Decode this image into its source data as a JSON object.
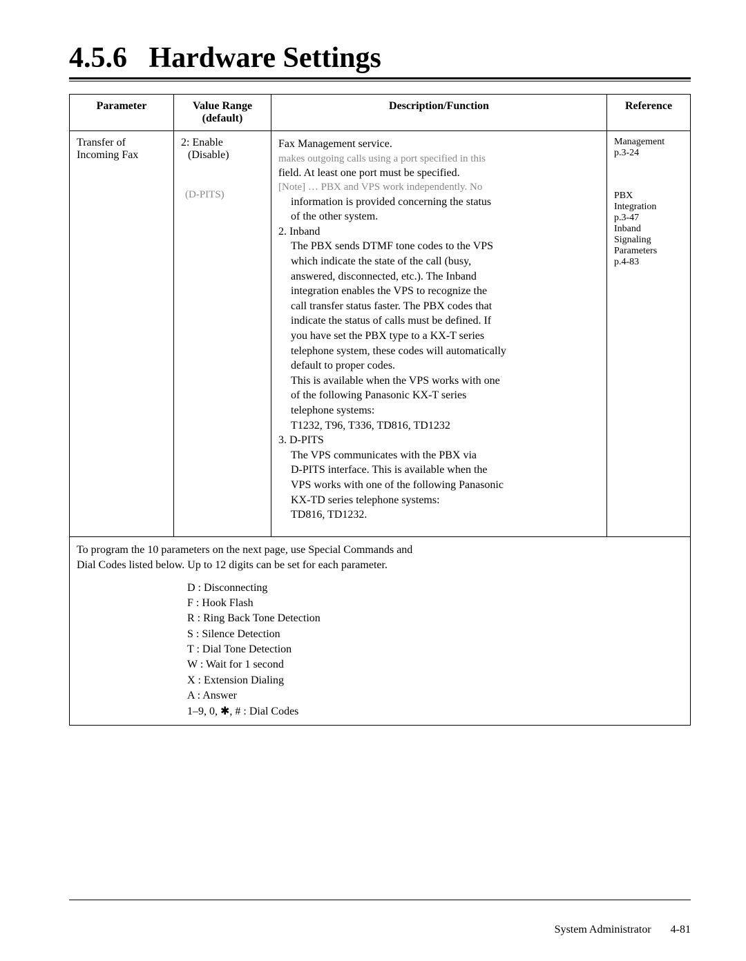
{
  "section_number": "4.5.6",
  "section_title": "Hardware Settings",
  "table": {
    "headers": {
      "parameter": "Parameter",
      "value_range": "Value Range (default)",
      "description": "Description/Function",
      "reference": "Reference"
    },
    "row": {
      "parameter_line1": "Transfer of",
      "parameter_line2": "Incoming Fax",
      "value_line1": "2: Enable",
      "value_line2": "(Disable)",
      "value_line3": "(D-PITS)",
      "desc_line1": "Fax Management service.",
      "desc_faded1": "makes outgoing calls using a port specified in this",
      "desc_line2": "field.  At least one port must be specified.",
      "desc_faded2": "[Note] … PBX and VPS work independently.  No",
      "desc_line3a": "information is provided concerning the status",
      "desc_line3b": "of the other system.",
      "desc_item2_hdr": "2.  Inband",
      "desc_item2_a": "The PBX sends DTMF tone codes to the VPS",
      "desc_item2_b": "which indicate the state of the call (busy,",
      "desc_item2_c": "answered, disconnected, etc.).  The Inband",
      "desc_item2_d": "integration enables the VPS to recognize the",
      "desc_item2_e": "call transfer status faster.  The PBX codes that",
      "desc_item2_f": "indicate the status of calls must be defined.    If",
      "desc_item2_g": "you have set the PBX type to a KX-T series",
      "desc_item2_h": "telephone system, these codes will automatically",
      "desc_item2_i": "default to proper codes.",
      "desc_item2_j": "This is available when the VPS works with one",
      "desc_item2_k": "of the following Panasonic KX-T series",
      "desc_item2_l": "telephone systems:",
      "desc_item2_m": "T1232, T96, T336, TD816, TD1232",
      "desc_item3_hdr": "3.  D-PITS",
      "desc_item3_a": "The VPS communicates with the PBX via",
      "desc_item3_b": "D-PITS interface.  This is available when the",
      "desc_item3_c": "VPS works with one of the following Panasonic",
      "desc_item3_d": "KX-TD series telephone systems:",
      "desc_item3_e": "TD816, TD1232.",
      "ref_line1": "Management",
      "ref_line2": "p.3-24",
      "ref_line3": "PBX",
      "ref_line4": "Integration",
      "ref_line5": "p.3-47",
      "ref_line6": "Inband",
      "ref_line7": "Signaling",
      "ref_line8": "Parameters",
      "ref_line9": "p.4-83"
    },
    "footer": {
      "para1": "To program the 10 parameters on the next page, use Special Commands and",
      "para2": "Dial Codes listed below.  Up to 12 digits can be set for each parameter.",
      "codes": {
        "d": "D : Disconnecting",
        "f": "F  : Hook Flash",
        "r": "R  : Ring Back Tone Detection",
        "s": "S  : Silence Detection",
        "t": "T  : Dial Tone Detection",
        "w": "W : Wait for 1 second",
        "x": "X  : Extension Dialing",
        "a": "A  : Answer",
        "digits": "1–9, 0, ✱, # : Dial Codes"
      }
    }
  },
  "page_footer": {
    "label": "System Administrator",
    "page": "4-81"
  }
}
